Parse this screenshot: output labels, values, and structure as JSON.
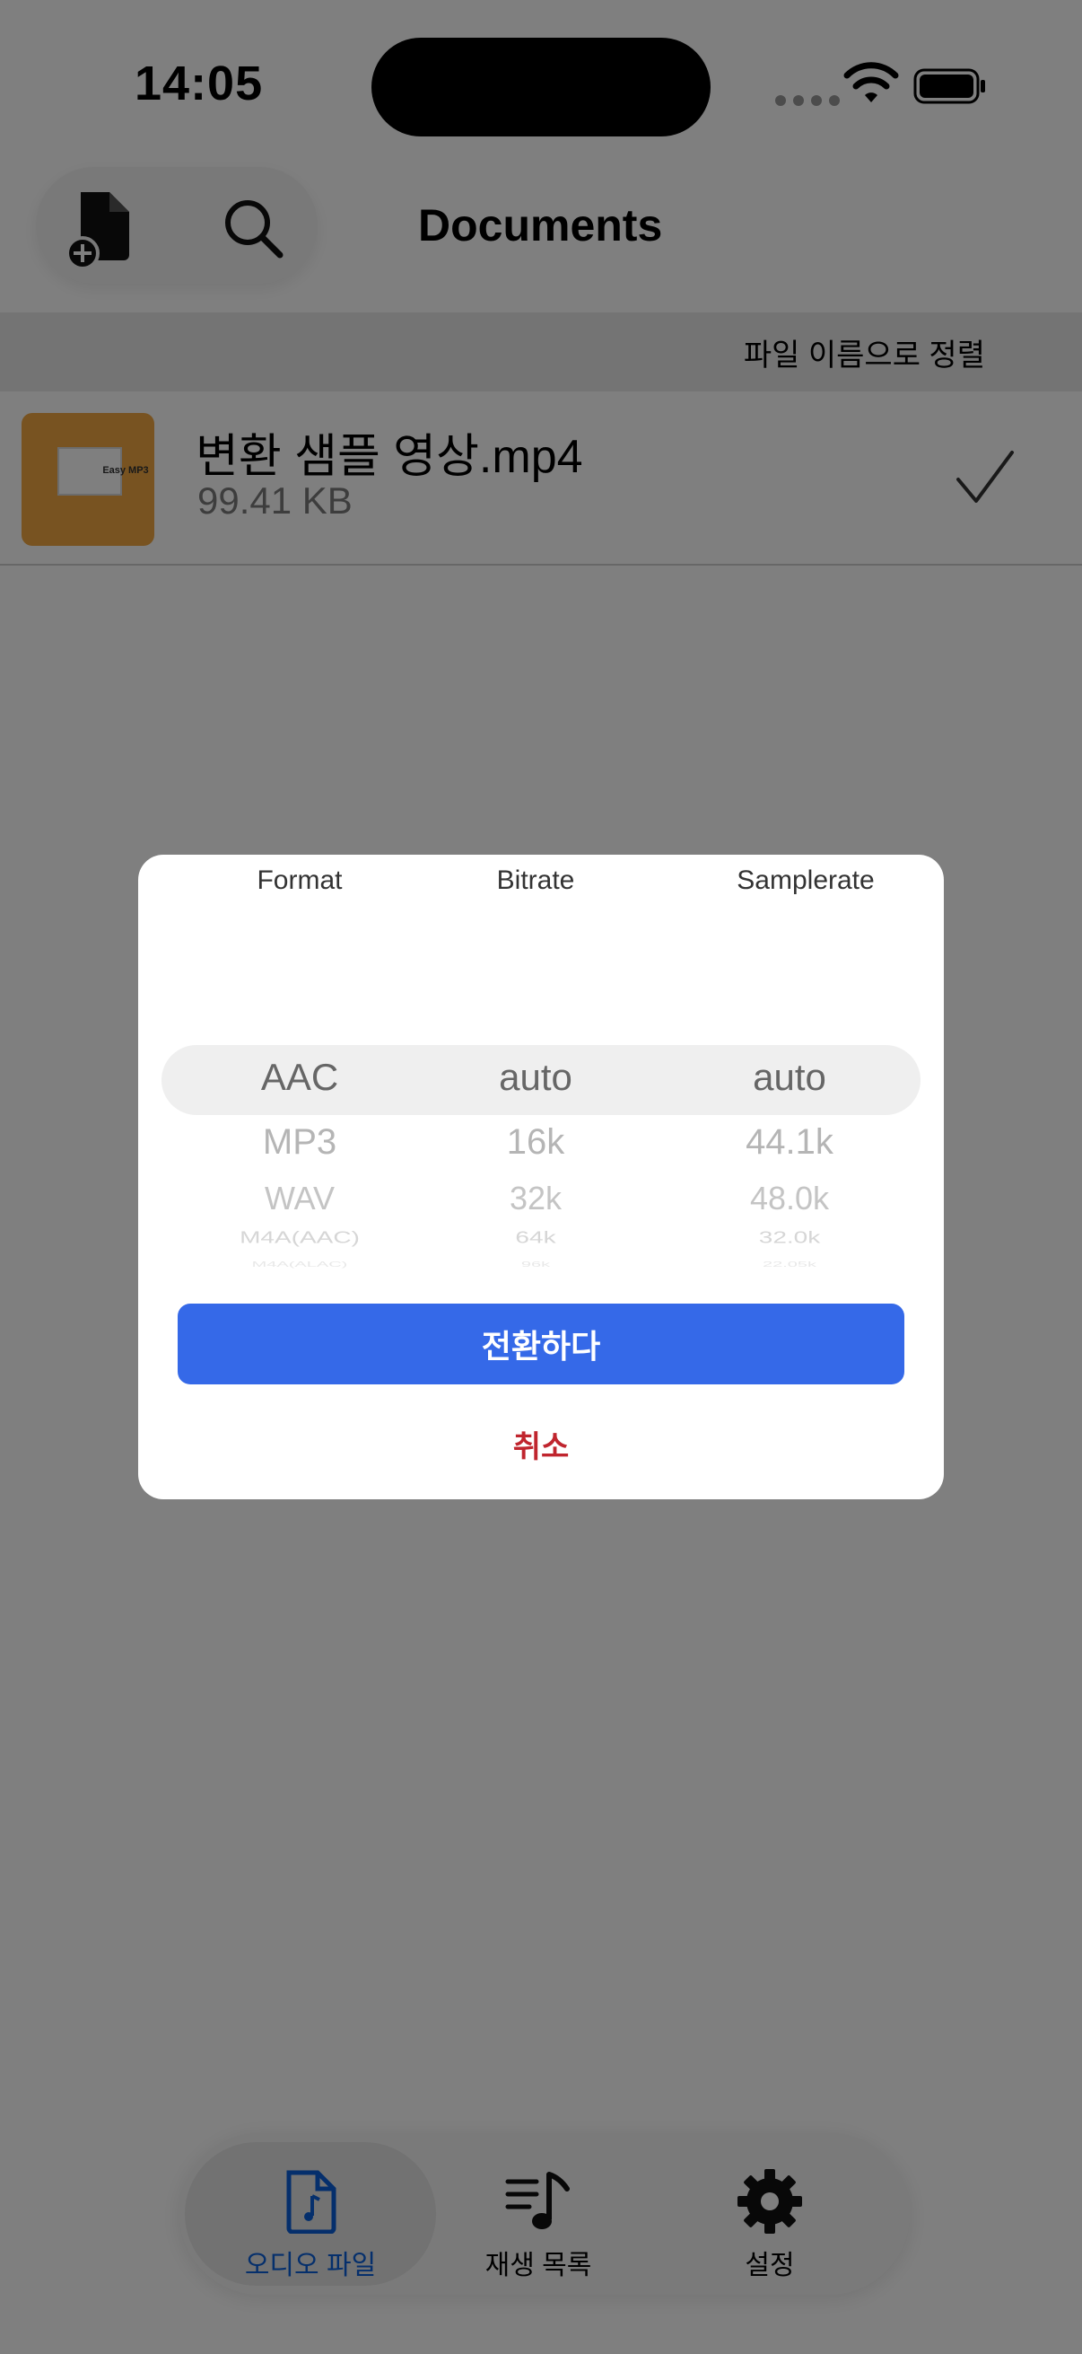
{
  "status_bar": {
    "time": "14:05"
  },
  "header": {
    "title": "Documents"
  },
  "sort": {
    "label": "파일 이름으로 정렬"
  },
  "files": [
    {
      "name": "변환 샘플 영상.mp4",
      "size": "99.41 KB",
      "thumb_text": "Easy MP3",
      "selected": true
    }
  ],
  "dialog": {
    "columns": {
      "format": "Format",
      "bitrate": "Bitrate",
      "samplerate": "Samplerate"
    },
    "format_options": [
      "AAC",
      "MP3",
      "WAV",
      "M4A(AAC)",
      "M4A(ALAC)"
    ],
    "bitrate_options": [
      "auto",
      "16k",
      "32k",
      "64k",
      "96k"
    ],
    "samplerate_options": [
      "auto",
      "44.1k",
      "48.0k",
      "32.0k",
      "22.05k"
    ],
    "convert_label": "전환하다",
    "cancel_label": "취소"
  },
  "tabs": [
    {
      "label": "오디오 파일",
      "icon": "audio-file-icon",
      "active": true
    },
    {
      "label": "재생 목록",
      "icon": "playlist-icon",
      "active": false
    },
    {
      "label": "설정",
      "icon": "gear-icon",
      "active": false
    }
  ],
  "colors": {
    "accent": "#3569e8",
    "active_tab": "#0a5fd8",
    "cancel": "#c0252e",
    "thumb": "#f0a742"
  }
}
